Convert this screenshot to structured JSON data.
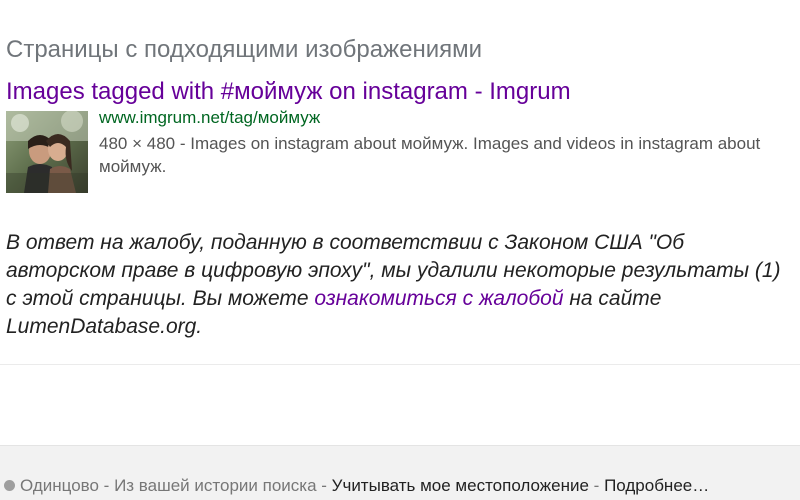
{
  "section": {
    "heading": "Страницы с подходящими изображениями"
  },
  "result": {
    "title": "Images tagged with #моймуж on instagram - Imgrum",
    "url": "www.imgrum.net/tag/моймуж",
    "dimensions": "480 × 480",
    "separator": " - ",
    "snippet": "Images on instagram about моймуж. Images and videos in instagram about моймуж.",
    "colors": {
      "title": "#660099",
      "url": "#006621"
    }
  },
  "notice": {
    "text_before": "В ответ на жалобу, поданную в соответствии с Законом США \"Об авторском праве в цифровую эпоху\", мы удалили некоторые результаты (1) с этой страницы. Вы можете ",
    "link_text": "ознакомиться с жалобой",
    "text_after": " на сайте LumenDatabase.org."
  },
  "footer": {
    "location": "Одинцово",
    "separator": " - ",
    "source": "Из вашей истории поиска",
    "use_location": "Учитывать мое местоположение",
    "more": "Подробнее…"
  }
}
